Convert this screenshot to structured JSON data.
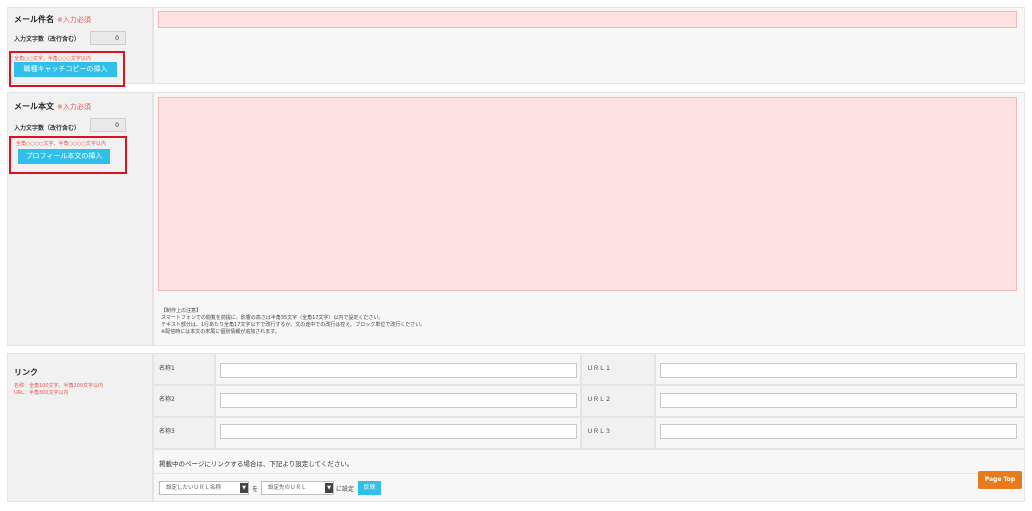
{
  "subject": {
    "title": "メール件名",
    "required": "※入力必須",
    "count_label": "入力文字数（改行含む）",
    "count_value": "0",
    "hint": "全角○○文字、半角○○○文字以内",
    "insert_button": "職種キャッチコピーの挿入"
  },
  "body": {
    "title": "メール本文",
    "required": "※入力必須",
    "count_label": "入力文字数（改行含む）",
    "count_value": "0",
    "hint": "全角○○○○文字、半角○○○○文字以内",
    "insert_button": "プロフィール本文の挿入",
    "note_lines": [
      "【制作上の注意】",
      "スマートフォンでの閲覧を前提に、影響の高さは半角35文字（全角17文字）以内で設定ください。",
      "テキスト部分は、1行あたり全角17文字以下で改行するか、文の途中での改行は控え、ブロック単位で改行ください。",
      "※配信時には本文の末尾に個別情報が追加されます。"
    ]
  },
  "links": {
    "title": "リンク",
    "hint_lines": [
      "名称：全角100文字、半角200文字以内",
      "URL：半角300文字以内"
    ],
    "rows": [
      {
        "name_label": "名称1",
        "url_label": "ＵＲＬ１"
      },
      {
        "name_label": "名称2",
        "url_label": "ＵＲＬ２"
      },
      {
        "name_label": "名称3",
        "url_label": "ＵＲＬ３"
      }
    ],
    "instruction": "掲載中のページにリンクする場合は、下記より設定してください。",
    "select1": "設定したいＵＲＬ名称",
    "connector1": "を",
    "select2": "設定先のＵＲＬ",
    "connector2": "に設定",
    "apply_button": "反映"
  },
  "page_top": "Page Top"
}
